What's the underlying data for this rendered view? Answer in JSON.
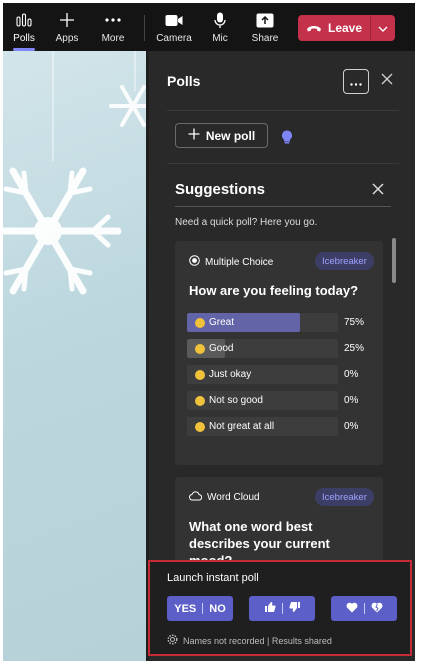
{
  "toolbar": {
    "items": [
      {
        "label": "Polls",
        "icon": "polls-icon",
        "active": true
      },
      {
        "label": "Apps",
        "icon": "plus-icon"
      },
      {
        "label": "More",
        "icon": "more-icon"
      },
      {
        "label": "Camera",
        "icon": "camera-icon"
      },
      {
        "label": "Mic",
        "icon": "mic-icon"
      },
      {
        "label": "Share",
        "icon": "share-icon"
      }
    ],
    "leave_label": "Leave"
  },
  "panel": {
    "title": "Polls",
    "new_poll_label": "New poll"
  },
  "suggestions": {
    "title": "Suggestions",
    "subtitle": "Need a quick poll? Here you go.",
    "cards": [
      {
        "type": "Multiple Choice",
        "tag": "Icebreaker",
        "question": "How are you feeling today?",
        "options": [
          {
            "label": "Great",
            "percent": "75%",
            "value": 0.75
          },
          {
            "label": "Good",
            "percent": "25%",
            "value": 0.25
          },
          {
            "label": "Just okay",
            "percent": "0%",
            "value": 0
          },
          {
            "label": "Not so good",
            "percent": "0%",
            "value": 0
          },
          {
            "label": "Not great at all",
            "percent": "0%",
            "value": 0
          }
        ]
      },
      {
        "type": "Word Cloud",
        "tag": "Icebreaker",
        "question": "What one word best describes your current mood?"
      }
    ]
  },
  "launch": {
    "title": "Launch instant poll",
    "yes_label": "YES",
    "no_label": "NO",
    "footer": "Names not recorded | Results shared"
  },
  "colors": {
    "accent": "#5b5fc7",
    "leave": "#c4314b",
    "highlight_border": "#c42b35",
    "tag_text": "#9ea2ff"
  }
}
